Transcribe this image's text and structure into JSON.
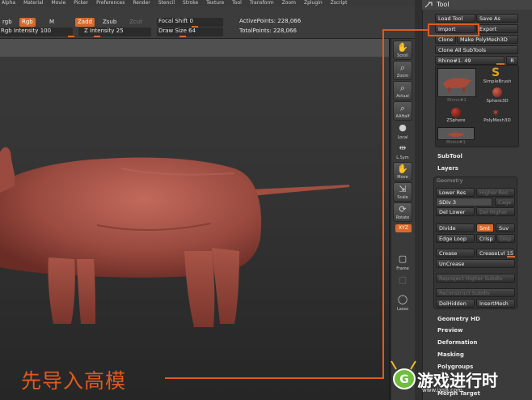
{
  "menu": [
    "Alpha",
    "Material",
    "Movie",
    "Picker",
    "Preferences",
    "Render",
    "Stencil",
    "Stroke",
    "Texture",
    "Tool",
    "Transform",
    "Zoom",
    "Zplugin",
    "Zscript"
  ],
  "shelf": {
    "rgb": "rgb",
    "rgb_btn": "Rgb",
    "m": "M",
    "zadd": "Zadd",
    "zsub": "Zsub",
    "zcut": "Zcut",
    "rgb_intensity_label": "Rgb Intensity",
    "rgb_intensity": "100",
    "z_intensity_label": "Z Intensity",
    "z_intensity": "25",
    "focal_shift_label": "Focal Shift",
    "focal_shift": "0",
    "draw_size_label": "Draw Size",
    "draw_size": "64",
    "active_points": "ActivePoints: 228,066",
    "total_points": "TotalPoints: 228,066"
  },
  "rightbar": [
    {
      "name": "scroll",
      "label": "Scroll",
      "glyph": "✋"
    },
    {
      "name": "zoom",
      "label": "Zoom",
      "glyph": "🔍"
    },
    {
      "name": "actual",
      "label": "Actual",
      "glyph": "🔍"
    },
    {
      "name": "aahalf",
      "label": "AAHalf",
      "glyph": "🔍"
    },
    {
      "name": "local",
      "label": "Local",
      "glyph": "●"
    },
    {
      "name": "lsym",
      "label": "L.Sym",
      "glyph": "⇹"
    },
    {
      "name": "move",
      "label": "Move",
      "glyph": "✋"
    },
    {
      "name": "scale",
      "label": "Scale",
      "glyph": "⇲"
    },
    {
      "name": "rotate",
      "label": "Rotate",
      "glyph": "⟳"
    },
    {
      "name": "frame",
      "label": "Frame",
      "glyph": "▢"
    },
    {
      "name": "lasso",
      "label": "Lasso",
      "glyph": "◯"
    }
  ],
  "xyz_label": "XYZ",
  "panel": {
    "title": "Tool",
    "load_tool": "Load Tool",
    "save_as": "Save As",
    "import": "Import",
    "export": "Export",
    "clone": "Clone",
    "make_polymesh": "Make PolyMesh3D",
    "clone_all": "Clone All SubTools",
    "current_tool": "Rhino#1. 49",
    "r": "R",
    "thumbs": [
      {
        "label": "Rhino#1"
      },
      {
        "label": "SimpleBrush"
      },
      {
        "label": "Sphere3D"
      },
      {
        "label": "ZSphere"
      },
      {
        "label": "PolyMesh3D"
      },
      {
        "label": "Rhino#1"
      }
    ],
    "subtool": "SubTool",
    "layers": "Layers",
    "geometry": "Geometry",
    "lower_res": "Lower Res",
    "higher_res": "Higher Res",
    "sdiv": "SDiv 3",
    "cage": "Cage",
    "del_lower": "Del Lower",
    "del_higher": "Del Higher",
    "divide": "Divide",
    "smt": "Smt",
    "suv": "Suv",
    "edge_loop": "Edge Loop",
    "crisp": "Crisp",
    "disp": "Disp",
    "crease": "Crease",
    "crease_lvl": "CreaseLvl 15",
    "uncrease": "UnCrease",
    "reproject": "Reproject Higher Subdiv",
    "reconstruct": "Reconstruct Subdiv",
    "del_hidden": "DelHidden",
    "insert_mesh": "InsertMesh",
    "geometry_hd": "Geometry HD",
    "preview": "Preview",
    "deformation": "Deformation",
    "masking": "Masking",
    "polygroups": "Polygroups",
    "morph_target": "Morph Target"
  },
  "annotation": "先导入高模",
  "logo": {
    "text": "游戏进行时",
    "url": "www.ixs8.com"
  }
}
